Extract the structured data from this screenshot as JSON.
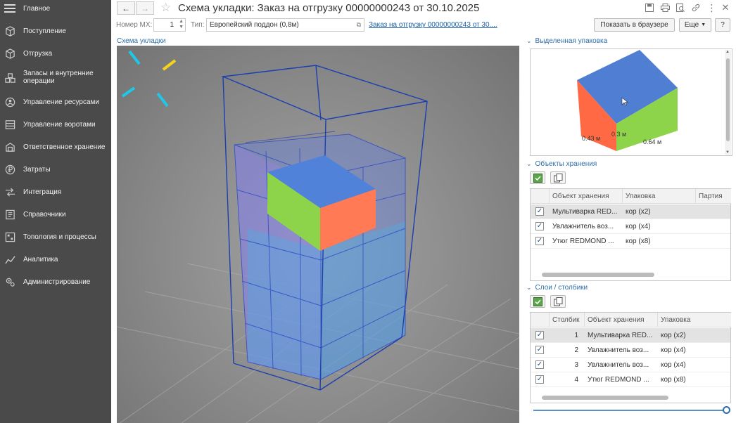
{
  "sidebar": {
    "menu_label": "Главное",
    "items": [
      {
        "label": "Поступление",
        "icon": "box-in-icon"
      },
      {
        "label": "Отгрузка",
        "icon": "box-out-icon"
      },
      {
        "label": "Запасы и внутренние операции",
        "icon": "stock-icon"
      },
      {
        "label": "Управление ресурсами",
        "icon": "resources-icon"
      },
      {
        "label": "Управление воротами",
        "icon": "gate-icon"
      },
      {
        "label": "Ответственное хранение",
        "icon": "storage-icon"
      },
      {
        "label": "Затраты",
        "icon": "ruble-icon"
      },
      {
        "label": "Интеграция",
        "icon": "integration-icon"
      },
      {
        "label": "Справочники",
        "icon": "directory-icon"
      },
      {
        "label": "Топология и процессы",
        "icon": "topology-icon"
      },
      {
        "label": "Аналитика",
        "icon": "analytics-icon"
      },
      {
        "label": "Администрирование",
        "icon": "admin-gear-icon"
      }
    ]
  },
  "header": {
    "title": "Схема укладки: Заказ на отгрузку 00000000243 от 30.10.2025"
  },
  "toolbar": {
    "mx_label": "Номер МХ:",
    "mx_value": "1",
    "type_label": "Тип:",
    "type_value": "Европейский поддон (0,8м)",
    "order_link": "Заказ на отгрузку 00000000243 от 30....",
    "browser_button": "Показать в браузере",
    "more_button": "Еще",
    "help_button": "?"
  },
  "viewport": {
    "label": "Схема укладки"
  },
  "selected_pack": {
    "header": "Выделенная упаковка",
    "dim_a": "0.43 м",
    "dim_b": "0.3 м",
    "dim_c": "0.64 м"
  },
  "storage_objects": {
    "header": "Объекты хранения",
    "columns": [
      "Объект хранения",
      "Упаковка",
      "Партия"
    ],
    "rows": [
      {
        "object": "Мультиварка RED...",
        "pack": "кор (x2)",
        "batch": ""
      },
      {
        "object": "Увлажнитель воз...",
        "pack": "кор (x4)",
        "batch": ""
      },
      {
        "object": "Утюг REDMOND ...",
        "pack": "кор (x8)",
        "batch": ""
      }
    ]
  },
  "layers": {
    "header": "Слои / столбики",
    "columns": [
      "Столбик",
      "Объект хранения",
      "Упаковка"
    ],
    "rows": [
      {
        "column": "1",
        "object": "Мультиварка RED...",
        "pack": "кор (x2)"
      },
      {
        "column": "2",
        "object": "Увлажнитель воз...",
        "pack": "кор (x4)"
      },
      {
        "column": "3",
        "object": "Увлажнитель воз...",
        "pack": "кор (x4)"
      },
      {
        "column": "4",
        "object": "Утюг REDMOND ...",
        "pack": "кор (x8)"
      }
    ]
  },
  "colors": {
    "sidebar_bg": "#4a4a4a",
    "accent_link": "#1a5fa6",
    "box_top": "#4f82d8",
    "box_left": "#ff7a55",
    "box_right": "#8ed44a",
    "wireframe": "#1c3fb0"
  }
}
